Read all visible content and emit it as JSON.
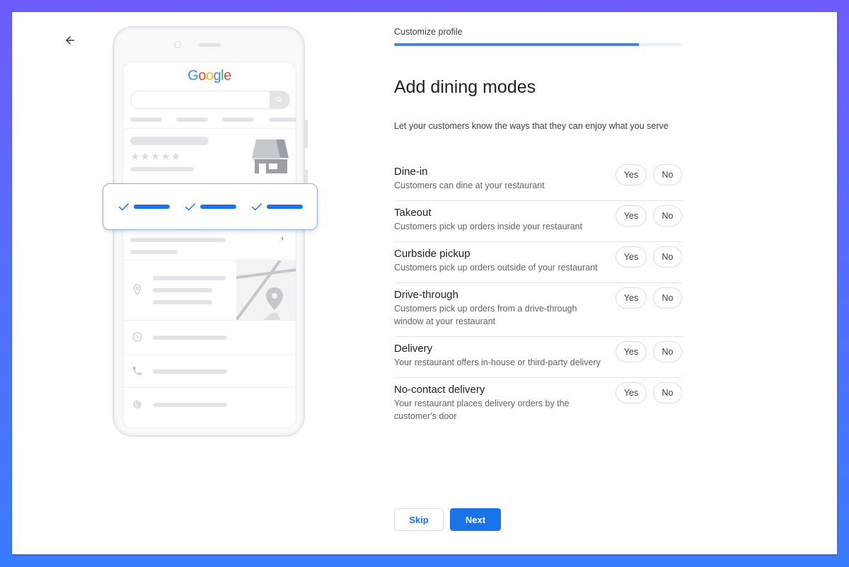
{
  "header": {
    "back_icon": "arrow-left-icon",
    "step_label": "Customize profile",
    "progress_percent": 85
  },
  "main": {
    "title": "Add dining modes",
    "subtitle": "Let your customers know the ways that they can enjoy what you serve",
    "modes": [
      {
        "name": "Dine-in",
        "description": "Customers can dine at your restaurant",
        "yes_label": "Yes",
        "no_label": "No"
      },
      {
        "name": "Takeout",
        "description": "Customers pick up orders inside your restaurant",
        "yes_label": "Yes",
        "no_label": "No"
      },
      {
        "name": "Curbside pickup",
        "description": "Customers pick up orders outside of your restaurant",
        "yes_label": "Yes",
        "no_label": "No"
      },
      {
        "name": "Drive-through",
        "description": "Customers pick up orders from a drive-through window at your restaurant",
        "yes_label": "Yes",
        "no_label": "No"
      },
      {
        "name": "Delivery",
        "description": "Your restaurant offers in-house or third-party delivery",
        "yes_label": "Yes",
        "no_label": "No"
      },
      {
        "name": "No-contact delivery",
        "description": "Your restaurant places delivery orders by the customer's door",
        "yes_label": "Yes",
        "no_label": "No"
      }
    ]
  },
  "actions": {
    "skip_label": "Skip",
    "next_label": "Next"
  },
  "illustration": {
    "logo_letters": [
      "G",
      "o",
      "o",
      "g",
      "l",
      "e"
    ],
    "stars": "★★★★★",
    "icons": [
      "search-icon",
      "storefront-icon",
      "check-icon",
      "chevron-right-icon",
      "location-pin-icon",
      "map-pin-icon",
      "clock-icon",
      "phone-icon",
      "globe-icon"
    ]
  },
  "colors": {
    "accent": "#1a73e8",
    "progress_fill": "#4a84d8",
    "progress_track": "#e8f0fe",
    "frame_top": "#6e5cff",
    "frame_bottom": "#3a7cff"
  }
}
